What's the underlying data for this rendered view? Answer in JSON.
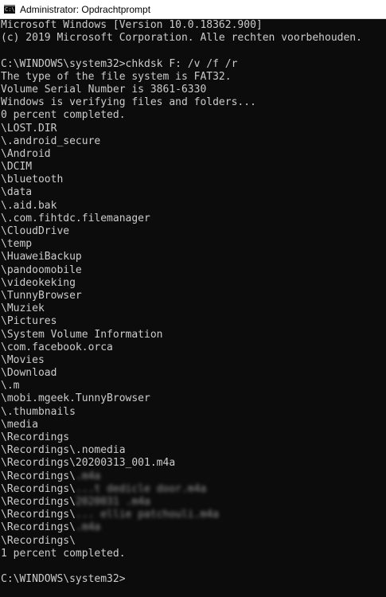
{
  "window": {
    "title": "Administrator: Opdrachtprompt",
    "icon": "cmd-icon",
    "icon_glyph": "C:\\"
  },
  "console": {
    "lines": [
      {
        "text": "Microsoft Windows [Version 10.0.18362.900]"
      },
      {
        "text": "(c) 2019 Microsoft Corporation. Alle rechten voorbehouden."
      },
      {
        "text": ""
      },
      {
        "text": "C:\\WINDOWS\\system32>chkdsk F: /v /f /r"
      },
      {
        "text": "The type of the file system is FAT32."
      },
      {
        "text": "Volume Serial Number is 3861-6330"
      },
      {
        "text": "Windows is verifying files and folders..."
      },
      {
        "text": "0 percent completed."
      },
      {
        "text": "\\LOST.DIR"
      },
      {
        "text": "\\.android_secure"
      },
      {
        "text": "\\Android"
      },
      {
        "text": "\\DCIM"
      },
      {
        "text": "\\bluetooth"
      },
      {
        "text": "\\data"
      },
      {
        "text": "\\.aid.bak"
      },
      {
        "text": "\\.com.fihtdc.filemanager"
      },
      {
        "text": "\\CloudDrive"
      },
      {
        "text": "\\temp"
      },
      {
        "text": "\\HuaweiBackup"
      },
      {
        "text": "\\pandoomobile"
      },
      {
        "text": "\\videokeking"
      },
      {
        "text": "\\TunnyBrowser"
      },
      {
        "text": "\\Muziek"
      },
      {
        "text": "\\Pictures"
      },
      {
        "text": "\\System Volume Information"
      },
      {
        "text": "\\com.facebook.orca"
      },
      {
        "text": "\\Movies"
      },
      {
        "text": "\\Download"
      },
      {
        "text": "\\.m"
      },
      {
        "text": "\\mobi.mgeek.TunnyBrowser"
      },
      {
        "text": "\\.thumbnails"
      },
      {
        "text": "\\media"
      },
      {
        "text": "\\Recordings"
      },
      {
        "text": "\\Recordings\\.nomedia"
      },
      {
        "text": "\\Recordings\\20200313_001.m4a"
      },
      {
        "text": "\\Recordings\\",
        "redacted": ".m4a"
      },
      {
        "text": "\\Recordings\\",
        "redacted": "...t dedicle door.m4a"
      },
      {
        "text": "\\Recordings\\",
        "redacted": "2020031 .m4a"
      },
      {
        "text": "\\Recordings\\",
        "redacted": "... ellie patchouli.m4a"
      },
      {
        "text": "\\Recordings\\",
        "redacted": ".m4a"
      },
      {
        "text": "\\Recordings\\",
        "redacted": ""
      },
      {
        "text": "1 percent completed."
      },
      {
        "text": ""
      },
      {
        "text": "C:\\WINDOWS\\system32>"
      }
    ]
  },
  "colors": {
    "console_background": "#0c0c0c",
    "console_text": "#cccccc",
    "titlebar_background": "#ffffff"
  }
}
